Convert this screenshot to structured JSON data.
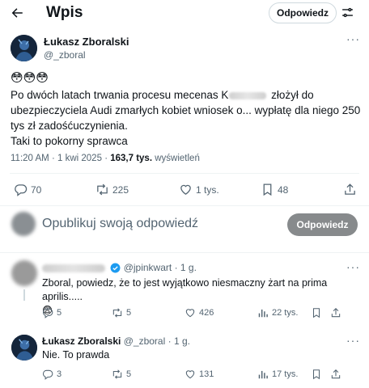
{
  "header": {
    "title": "Wpis",
    "reply_button": "Odpowiedz"
  },
  "tweet": {
    "author_name": "Łukasz Zboralski",
    "author_handle": "@_zboral",
    "emoji": "😳😳😳",
    "text_line1_pre": "Po dwóch latach trwania procesu mecenas K",
    "text_line1_post": " złożył do",
    "text_line2": "ubezpieczyciela Audi zmarłych kobiet wniosek o... wypłatę dla niego 250",
    "text_line3": "tys zł zadośćuczynienia.",
    "text_line4": "Taki to pokorny sprawca",
    "time": "11:20 AM",
    "date": "1 kwi 2025",
    "dot": "·",
    "views_count": "163,7 tys.",
    "views_label": "wyświetleń",
    "replies": "70",
    "reposts": "225",
    "likes": "1 tys.",
    "bookmarks": "48"
  },
  "composer": {
    "placeholder": "Opublikuj swoją odpowiedź",
    "button": "Odpowiedz"
  },
  "replies": [
    {
      "handle": "@jpinkwart",
      "time": "1 g.",
      "text": "Zboral, powiedz, że to jest wyjątkowo niesmaczny żart na prima aprilis.....",
      "emoji": "😨",
      "replies": "5",
      "reposts": "5",
      "likes": "426",
      "views": "22 tys."
    },
    {
      "name": "Łukasz Zboralski",
      "handle": "@_zboral",
      "time": "1 g.",
      "text": "Nie. To prawda",
      "replies": "3",
      "reposts": "5",
      "likes": "131",
      "views": "17 tys."
    }
  ],
  "colors": {
    "accent": "#1d9bf0",
    "muted": "#536471",
    "button_gray": "#878a8c"
  }
}
